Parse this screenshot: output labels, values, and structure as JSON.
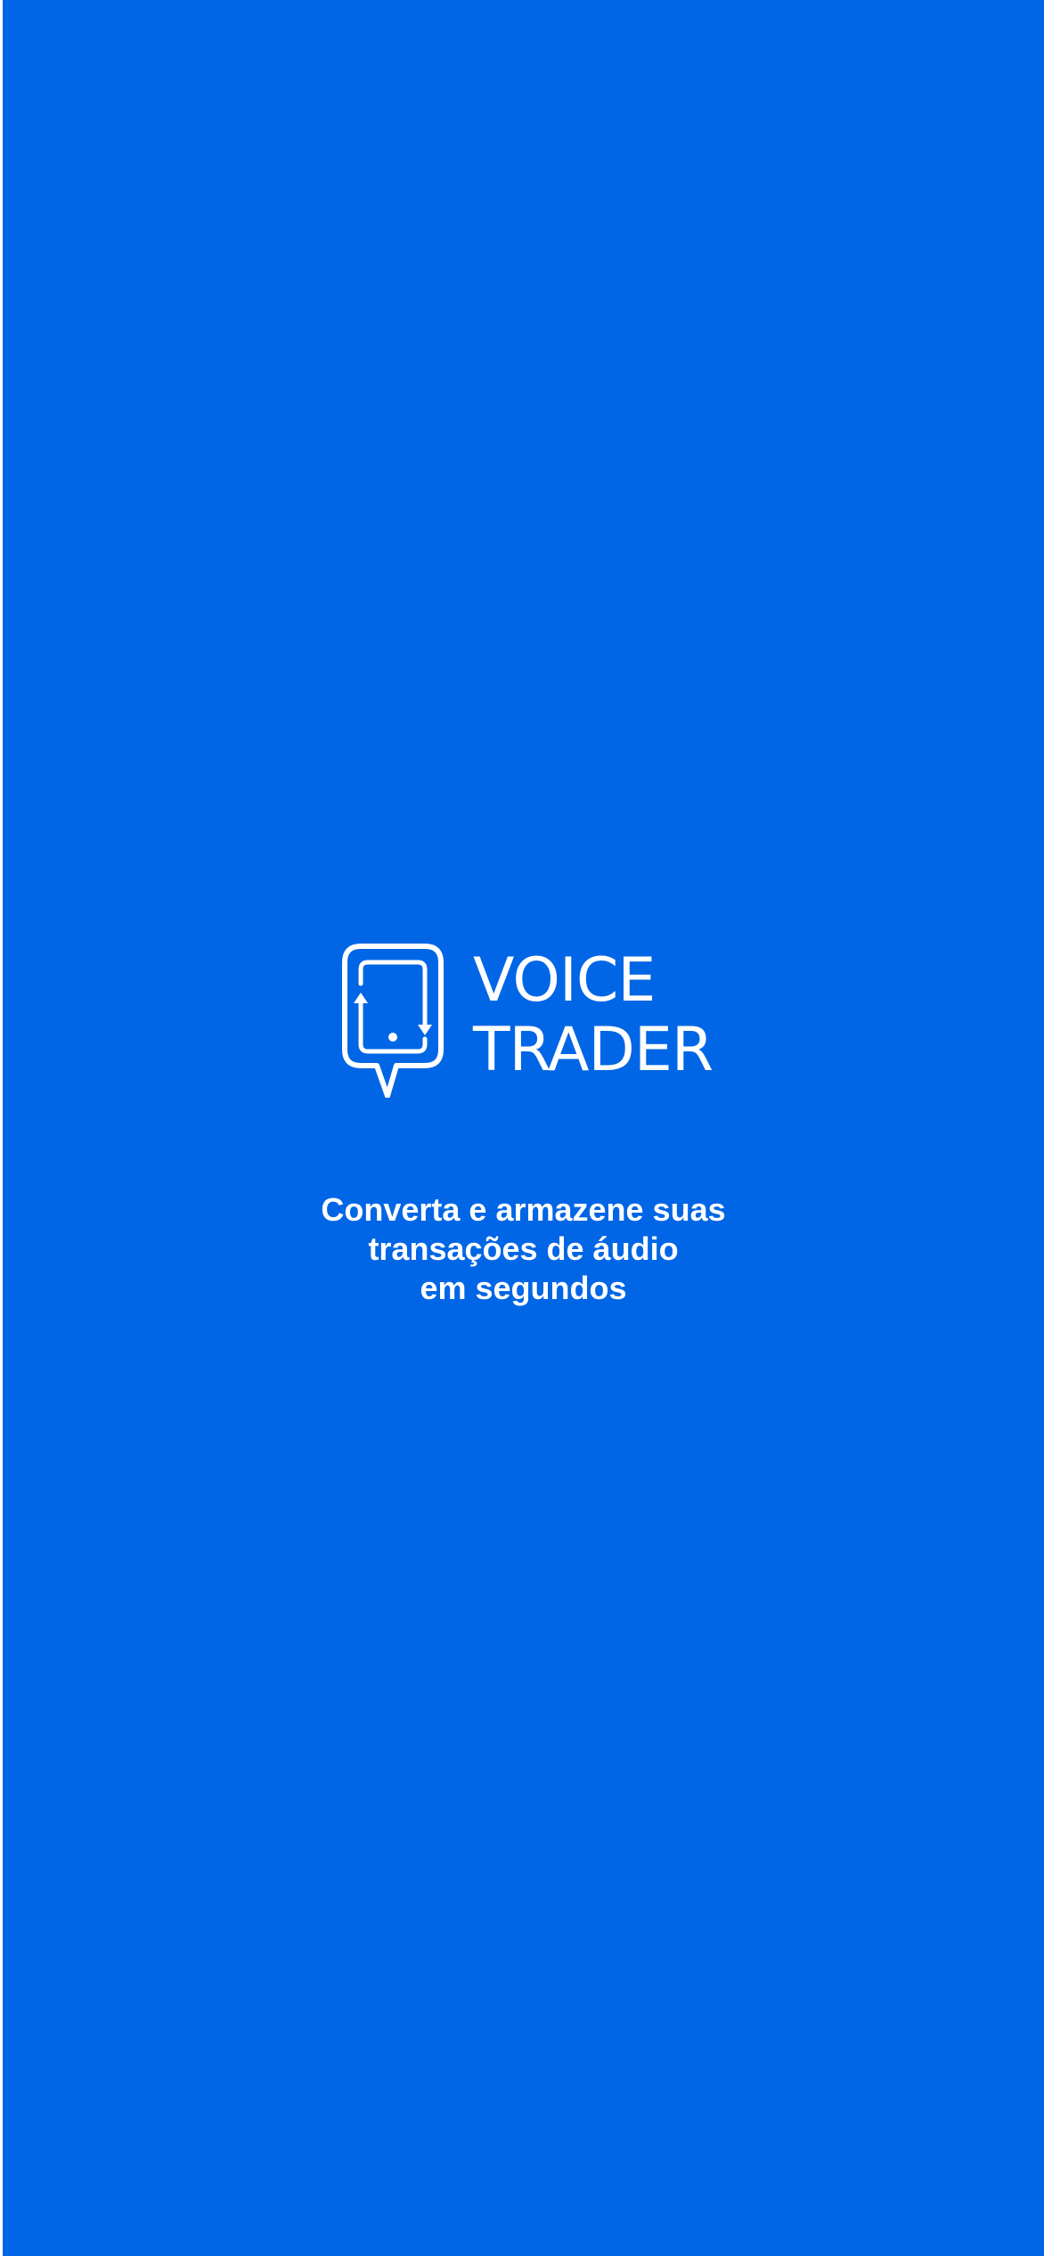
{
  "splash": {
    "background_color": "#0066E5",
    "foreground_color": "#FFFFFF",
    "logo": {
      "icon": "phone-speech-bubble-icon",
      "wordmark_line1": "VOICE",
      "wordmark_line2": "TRADER"
    },
    "tagline": {
      "line1": "Converta e armazene suas",
      "line2": "transações de áudio",
      "line3": "em segundos"
    }
  }
}
